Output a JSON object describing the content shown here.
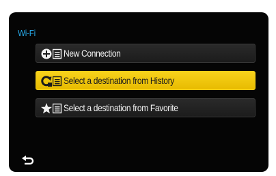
{
  "header": {
    "title": "Wi-Fi"
  },
  "menu": {
    "items": [
      {
        "label": "New Connection",
        "icon": "plus-list-icon",
        "selected": false
      },
      {
        "label": "Select a destination from History",
        "icon": "history-list-icon",
        "selected": true
      },
      {
        "label": "Select a destination from Favorite",
        "icon": "star-list-icon",
        "selected": false
      }
    ]
  },
  "footer": {
    "back_icon": "return-arrow-icon"
  },
  "colors": {
    "title": "#27a9e8",
    "selection": "#f5cd12",
    "item_background": "#242424",
    "screen_background": "#050505"
  }
}
